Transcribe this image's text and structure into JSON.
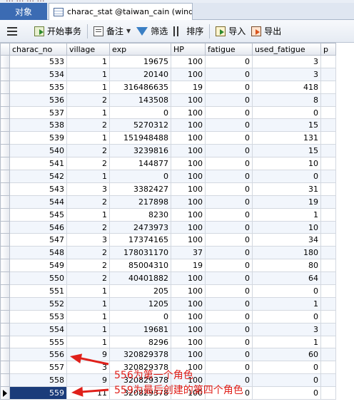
{
  "top_strip_text": "… … … …",
  "tabs": {
    "objects_label": "对象",
    "table_tab_label": "charac_stat @taiwan_cain (wind..."
  },
  "toolbar": {
    "begin_tx": "开始事务",
    "note": "备注",
    "filter": "筛选",
    "sort": "排序",
    "import": "导入",
    "export": "导出"
  },
  "columns": [
    "charac_no",
    "village",
    "exp",
    "HP",
    "fatigue",
    "used_fatigue",
    "p"
  ],
  "rows": [
    [
      "533",
      "1",
      "19675",
      "100",
      "0",
      "3"
    ],
    [
      "534",
      "1",
      "20140",
      "100",
      "0",
      "3"
    ],
    [
      "535",
      "1",
      "316486635",
      "19",
      "0",
      "418"
    ],
    [
      "536",
      "2",
      "143508",
      "100",
      "0",
      "8"
    ],
    [
      "537",
      "1",
      "0",
      "100",
      "0",
      "0"
    ],
    [
      "538",
      "2",
      "5270312",
      "100",
      "0",
      "15"
    ],
    [
      "539",
      "1",
      "151948488",
      "100",
      "0",
      "131"
    ],
    [
      "540",
      "2",
      "3239816",
      "100",
      "0",
      "15"
    ],
    [
      "541",
      "2",
      "144877",
      "100",
      "0",
      "10"
    ],
    [
      "542",
      "1",
      "0",
      "100",
      "0",
      "0"
    ],
    [
      "543",
      "3",
      "3382427",
      "100",
      "0",
      "31"
    ],
    [
      "544",
      "2",
      "217898",
      "100",
      "0",
      "19"
    ],
    [
      "545",
      "1",
      "8230",
      "100",
      "0",
      "1"
    ],
    [
      "546",
      "2",
      "2473973",
      "100",
      "0",
      "10"
    ],
    [
      "547",
      "3",
      "17374165",
      "100",
      "0",
      "34"
    ],
    [
      "548",
      "2",
      "178031170",
      "37",
      "0",
      "180"
    ],
    [
      "549",
      "2",
      "85004310",
      "19",
      "0",
      "80"
    ],
    [
      "550",
      "2",
      "40401882",
      "100",
      "0",
      "64"
    ],
    [
      "551",
      "1",
      "205",
      "100",
      "0",
      "0"
    ],
    [
      "552",
      "1",
      "1205",
      "100",
      "0",
      "1"
    ],
    [
      "553",
      "1",
      "0",
      "100",
      "0",
      "0"
    ],
    [
      "554",
      "1",
      "19681",
      "100",
      "0",
      "3"
    ],
    [
      "555",
      "1",
      "8296",
      "100",
      "0",
      "1"
    ],
    [
      "556",
      "9",
      "320829378",
      "100",
      "0",
      "60"
    ],
    [
      "557",
      "3",
      "320829378",
      "100",
      "0",
      "0"
    ],
    [
      "558",
      "9",
      "320829378",
      "100",
      "0",
      "0"
    ],
    [
      "559",
      "11",
      "320829378",
      "100",
      "0",
      "0"
    ]
  ],
  "selected_row": "559",
  "annotations": {
    "first": "556为第一个角色",
    "second": "559为最后创建的第四个角色",
    "color": "#e0201a"
  }
}
